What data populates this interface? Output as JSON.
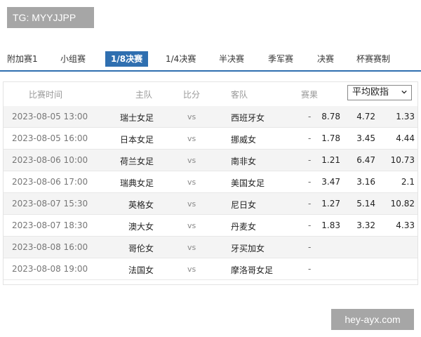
{
  "tg_badge": "TG: MYYJJPP",
  "watermark": "hey-ayx.com",
  "tabs": [
    {
      "label": "附加赛1"
    },
    {
      "label": "小组赛"
    },
    {
      "label": "1/8决赛",
      "active": true
    },
    {
      "label": "1/4决赛"
    },
    {
      "label": "半决赛"
    },
    {
      "label": "季军赛"
    },
    {
      "label": "决赛"
    },
    {
      "label": "杯赛赛制"
    }
  ],
  "table": {
    "headers": {
      "time": "比赛时间",
      "home": "主队",
      "score": "比分",
      "away": "客队",
      "result": "赛果"
    },
    "odds_select": "平均欧指",
    "rows": [
      {
        "time": "2023-08-05 13:00",
        "home": "瑞士女足",
        "vs": "vs",
        "away": "西班牙女",
        "result": "-",
        "o1": "8.78",
        "o2": "4.72",
        "o3": "1.33"
      },
      {
        "time": "2023-08-05 16:00",
        "home": "日本女足",
        "vs": "vs",
        "away": "挪威女",
        "result": "-",
        "o1": "1.78",
        "o2": "3.45",
        "o3": "4.44"
      },
      {
        "time": "2023-08-06 10:00",
        "home": "荷兰女足",
        "vs": "vs",
        "away": "南非女",
        "result": "-",
        "o1": "1.21",
        "o2": "6.47",
        "o3": "10.73"
      },
      {
        "time": "2023-08-06 17:00",
        "home": "瑞典女足",
        "vs": "vs",
        "away": "美国女足",
        "result": "-",
        "o1": "3.47",
        "o2": "3.16",
        "o3": "2.1"
      },
      {
        "time": "2023-08-07 15:30",
        "home": "英格女",
        "vs": "vs",
        "away": "尼日女",
        "result": "-",
        "o1": "1.27",
        "o2": "5.14",
        "o3": "10.82"
      },
      {
        "time": "2023-08-07 18:30",
        "home": "澳大女",
        "vs": "vs",
        "away": "丹麦女",
        "result": "-",
        "o1": "1.83",
        "o2": "3.32",
        "o3": "4.33"
      },
      {
        "time": "2023-08-08 16:00",
        "home": "哥伦女",
        "vs": "vs",
        "away": "牙买加女",
        "result": "-",
        "o1": "",
        "o2": "",
        "o3": ""
      },
      {
        "time": "2023-08-08 19:00",
        "home": "法国女",
        "vs": "vs",
        "away": "摩洛哥女足",
        "result": "-",
        "o1": "",
        "o2": "",
        "o3": ""
      }
    ]
  },
  "colors": {
    "accent": "#2f6fb0",
    "row_alt": "#f4f4f4",
    "badge_bg": "#a6a6a6"
  }
}
